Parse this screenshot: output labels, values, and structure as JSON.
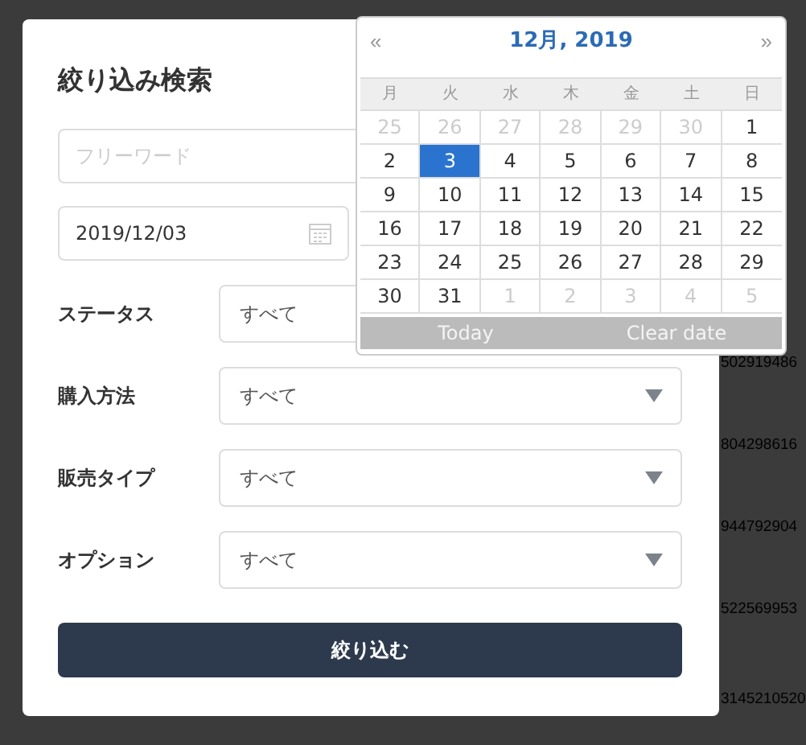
{
  "background_rows": [
    {
      "text": "502919486"
    },
    {
      "text": "804298616"
    },
    {
      "text": "944792904"
    },
    {
      "text": "522569953"
    },
    {
      "text": "3145210520"
    }
  ],
  "dialog": {
    "title": "絞り込み検索",
    "keyword": {
      "placeholder": "フリーワード"
    },
    "date": {
      "value": "2019/12/03"
    },
    "filters": [
      {
        "label": "ステータス",
        "value": "すべて"
      },
      {
        "label": "購入方法",
        "value": "すべて"
      },
      {
        "label": "販売タイプ",
        "value": "すべて"
      },
      {
        "label": "オプション",
        "value": "すべて"
      }
    ],
    "submit": "絞り込む"
  },
  "datepicker": {
    "prev": "«",
    "title": "12月, 2019",
    "next": "»",
    "weekdays": [
      "月",
      "火",
      "水",
      "木",
      "金",
      "土",
      "日"
    ],
    "weeks": [
      [
        {
          "day": "25",
          "muted": true,
          "selected": false
        },
        {
          "day": "26",
          "muted": true,
          "selected": false
        },
        {
          "day": "27",
          "muted": true,
          "selected": false
        },
        {
          "day": "28",
          "muted": true,
          "selected": false
        },
        {
          "day": "29",
          "muted": true,
          "selected": false
        },
        {
          "day": "30",
          "muted": true,
          "selected": false
        },
        {
          "day": "1",
          "muted": false,
          "selected": false
        }
      ],
      [
        {
          "day": "2",
          "muted": false,
          "selected": false
        },
        {
          "day": "3",
          "muted": false,
          "selected": true
        },
        {
          "day": "4",
          "muted": false,
          "selected": false
        },
        {
          "day": "5",
          "muted": false,
          "selected": false
        },
        {
          "day": "6",
          "muted": false,
          "selected": false
        },
        {
          "day": "7",
          "muted": false,
          "selected": false
        },
        {
          "day": "8",
          "muted": false,
          "selected": false
        }
      ],
      [
        {
          "day": "9",
          "muted": false,
          "selected": false
        },
        {
          "day": "10",
          "muted": false,
          "selected": false
        },
        {
          "day": "11",
          "muted": false,
          "selected": false
        },
        {
          "day": "12",
          "muted": false,
          "selected": false
        },
        {
          "day": "13",
          "muted": false,
          "selected": false
        },
        {
          "day": "14",
          "muted": false,
          "selected": false
        },
        {
          "day": "15",
          "muted": false,
          "selected": false
        }
      ],
      [
        {
          "day": "16",
          "muted": false,
          "selected": false
        },
        {
          "day": "17",
          "muted": false,
          "selected": false
        },
        {
          "day": "18",
          "muted": false,
          "selected": false
        },
        {
          "day": "19",
          "muted": false,
          "selected": false
        },
        {
          "day": "20",
          "muted": false,
          "selected": false
        },
        {
          "day": "21",
          "muted": false,
          "selected": false
        },
        {
          "day": "22",
          "muted": false,
          "selected": false
        }
      ],
      [
        {
          "day": "23",
          "muted": false,
          "selected": false
        },
        {
          "day": "24",
          "muted": false,
          "selected": false
        },
        {
          "day": "25",
          "muted": false,
          "selected": false
        },
        {
          "day": "26",
          "muted": false,
          "selected": false
        },
        {
          "day": "27",
          "muted": false,
          "selected": false
        },
        {
          "day": "28",
          "muted": false,
          "selected": false
        },
        {
          "day": "29",
          "muted": false,
          "selected": false
        }
      ],
      [
        {
          "day": "30",
          "muted": false,
          "selected": false
        },
        {
          "day": "31",
          "muted": false,
          "selected": false
        },
        {
          "day": "1",
          "muted": true,
          "selected": false
        },
        {
          "day": "2",
          "muted": true,
          "selected": false
        },
        {
          "day": "3",
          "muted": true,
          "selected": false
        },
        {
          "day": "4",
          "muted": true,
          "selected": false
        },
        {
          "day": "5",
          "muted": true,
          "selected": false
        }
      ]
    ],
    "today": "Today",
    "clear": "Clear date"
  }
}
